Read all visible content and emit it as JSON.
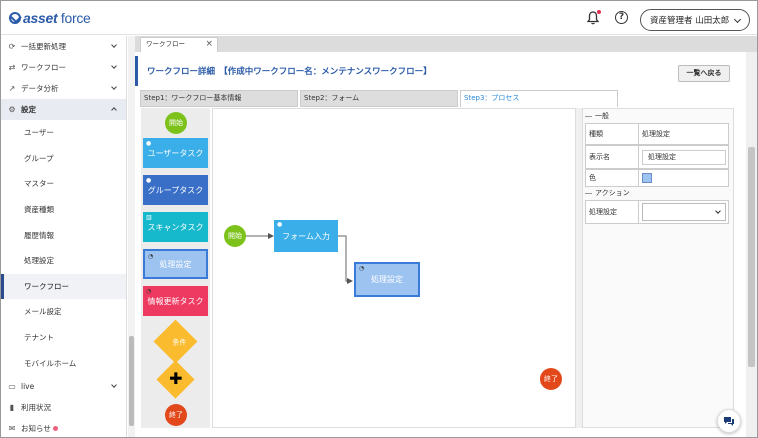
{
  "header": {
    "logo": "asset force",
    "user_label": "資産管理者 山田太郎"
  },
  "sidebar": {
    "items": [
      {
        "label": "一括更新処理",
        "icon": "refresh-icon"
      },
      {
        "label": "ワークフロー",
        "icon": "workflow-icon"
      },
      {
        "label": "データ分析",
        "icon": "chart-icon"
      },
      {
        "label": "設定",
        "icon": "gear-icon"
      }
    ],
    "settings_sub": [
      "ユーザー",
      "グループ",
      "マスター",
      "資産種類",
      "履歴情報",
      "処理設定",
      "ワークフロー",
      "メール設定",
      "テナント",
      "モバイルホーム"
    ],
    "bottom_items": [
      {
        "label": "live",
        "icon": "live-icon"
      },
      {
        "label": "利用状況",
        "icon": "bar-chart-icon"
      },
      {
        "label": "お知らせ",
        "icon": "megaphone-icon"
      }
    ]
  },
  "tab": {
    "label": "ワークフロー"
  },
  "page": {
    "title": "ワークフロー詳細　【作成中ワークフロー名：メンテナンスワークフロー】",
    "back_button": "一覧へ戻る",
    "steps": [
      "Step1：ワークフロー基本情報",
      "Step2：フォーム",
      "Step3：プロセス"
    ]
  },
  "palette": {
    "start": "開始",
    "user_task": "ユーザータスク",
    "group_task": "グループタスク",
    "scan_task": "スキャンタスク",
    "process_setting": "処理設定",
    "info_update_task": "情報更新タスク",
    "condition": "条件",
    "end": "終了"
  },
  "canvas": {
    "start": "開始",
    "form_input": "フォーム入力",
    "process_setting": "処理設定",
    "end": "終了"
  },
  "props": {
    "general_title": "一般",
    "type_label": "種類",
    "type_value": "処理設定",
    "display_name_label": "表示名",
    "display_name_value": "処理設定",
    "color_label": "色",
    "color_value": "#9dc3f0",
    "action_title": "アクション",
    "process_setting_label": "処理設定",
    "process_setting_value": ""
  },
  "colors": {
    "brand": "#2a5aa8",
    "start_green": "#7cc21a",
    "end_red": "#e2481a",
    "user_task": "#3aaee8",
    "group_task": "#3a6fc8",
    "scan_task": "#16b8cc",
    "process_setting": "#9dc3f0",
    "info_update_task": "#ee3a60",
    "condition": "#fbbb2e"
  }
}
